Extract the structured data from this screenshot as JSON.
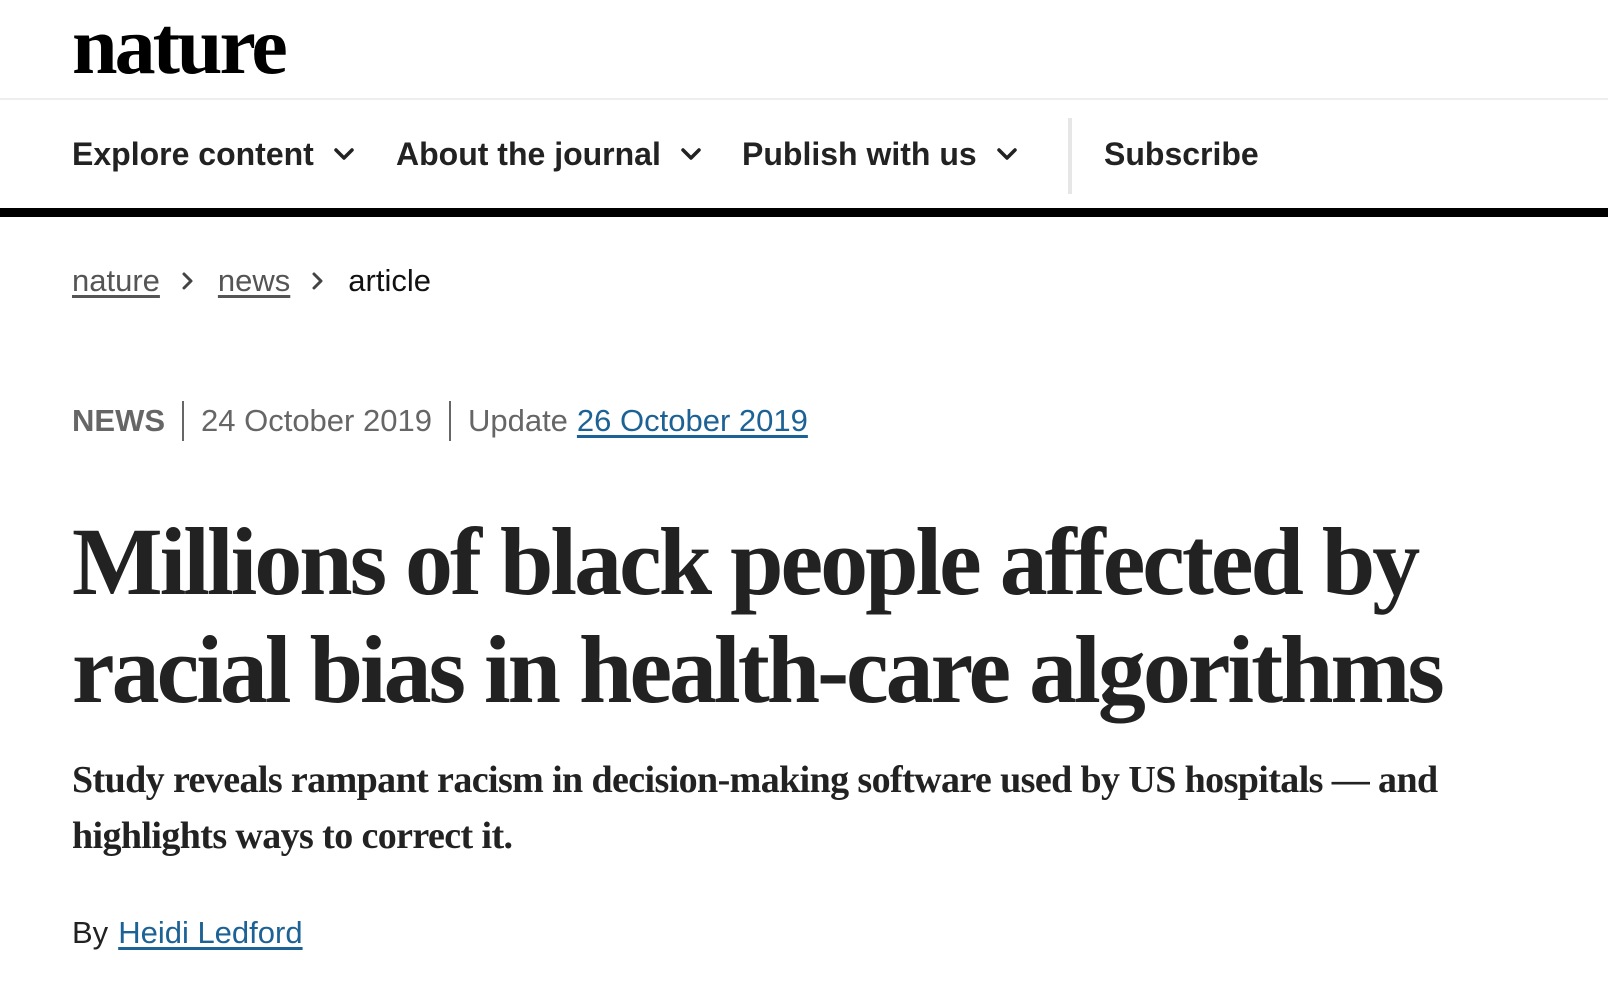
{
  "header": {
    "logo_text": "nature"
  },
  "nav": {
    "items": [
      {
        "label": "Explore content",
        "icon": "chevron-down-icon"
      },
      {
        "label": "About the journal",
        "icon": "chevron-down-icon"
      },
      {
        "label": "Publish with us",
        "icon": "chevron-down-icon"
      }
    ],
    "subscribe_label": "Subscribe"
  },
  "breadcrumb": {
    "items": [
      "nature",
      "news",
      "article"
    ],
    "separator_icon": "chevron-right-icon"
  },
  "article": {
    "type": "NEWS",
    "published_date": "24 October 2019",
    "update_label": "Update",
    "update_date": "26 October 2019",
    "title": "Millions of black people affected by racial bias in health-care algorithms",
    "standfirst": "Study reveals rampant racism in decision-making software used by US hospitals — and highlights ways to correct it.",
    "byline_prefix": "By",
    "author": "Heidi Ledford"
  },
  "colors": {
    "text": "#222222",
    "muted": "#666666",
    "link": "#1d6295",
    "nav_rule": "#000000"
  }
}
